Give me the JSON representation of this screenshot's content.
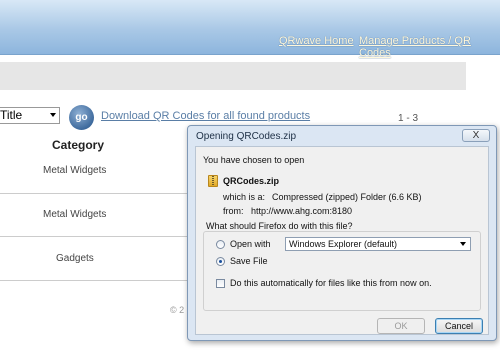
{
  "nav": {
    "home_link": "QRwave Home",
    "manage_link": "Manage Products / QR Codes"
  },
  "toolbar": {
    "sort_value": "Title",
    "go_label": "go",
    "download_link": "Download QR Codes for all found products",
    "pager": "1 - 3"
  },
  "table": {
    "column_header": "Category",
    "rows": [
      {
        "category": "Metal Widgets"
      },
      {
        "category": "Metal Widgets"
      },
      {
        "category": "Gadgets"
      }
    ]
  },
  "footer": {
    "text": "© 2"
  },
  "dialog": {
    "title": "Opening QRCodes.zip",
    "close_label": "X",
    "intro": "You have chosen to open",
    "filename": "QRCodes.zip",
    "which_is_label": "which is a:",
    "which_is_value": "Compressed (zipped) Folder (6.6 KB)",
    "from_label": "from:",
    "from_value": "http://www.ahg.com:8180",
    "question": "What should Firefox do with this file?",
    "open_with_label": "Open with",
    "open_with_app": "Windows Explorer (default)",
    "save_file_label": "Save File",
    "auto_label": "Do this automatically for files like this from now on.",
    "ok_label": "OK",
    "cancel_label": "Cancel",
    "selected_option": "Save File"
  }
}
